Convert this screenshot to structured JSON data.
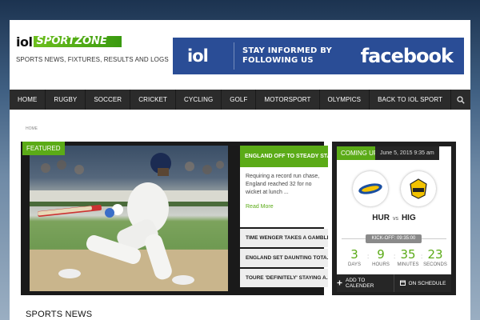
{
  "header": {
    "logo_iol": "iol",
    "logo_sportzone": "SPORTZONE",
    "tagline": "SPORTS NEWS, FIXTURES, RESULTS AND LOGS"
  },
  "banner": {
    "brand": "iol",
    "text_line1": "STAY INFORMED BY",
    "text_line2": "FOLLOWING US",
    "facebook": "facebook",
    "color": "#2a4d96"
  },
  "nav": {
    "items": [
      "HOME",
      "RUGBY",
      "SOCCER",
      "CRICKET",
      "CYCLING",
      "GOLF",
      "MOTORSPORT",
      "OLYMPICS",
      "BACK TO IOL SPORT"
    ],
    "search_icon": "search-icon"
  },
  "breadcrumb": "HOME",
  "featured": {
    "tag": "FEATURED",
    "headline": "ENGLAND OFF TO STEADY STAR...",
    "excerpt": "Requiring a record run chase, England reached 32 for no wicket at lunch ...",
    "read_more": "Read More",
    "list": [
      "TIME WENGER TAKES A GAMBLE",
      "ENGLAND SET DAUNTING TOTA...",
      "TOURE 'DEFINITELY' STAYING A..."
    ],
    "accent": "#5bab17"
  },
  "coming_up": {
    "tag": "COMING UP",
    "date": "June 5, 2015 9:35 am",
    "home": "HUR",
    "vs": "vs",
    "away": "HIG",
    "kickoff": "KICK-OFF: 09:35:00",
    "countdown": {
      "days": "3",
      "days_label": "DAYS",
      "hours": "9",
      "hours_label": "HOURS",
      "minutes": "35",
      "minutes_label": "MINUTES",
      "seconds": "23",
      "seconds_label": "SECONDS"
    },
    "add_to_calendar": "ADD TO CALENDER",
    "on_schedule": "ON SCHEDULE"
  },
  "section_title": "SPORTS NEWS"
}
